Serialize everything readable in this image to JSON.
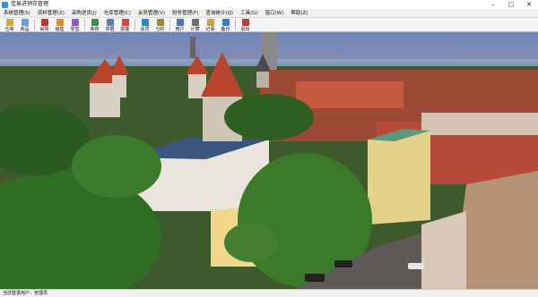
{
  "window": {
    "title": "佳易进销存管理"
  },
  "menu": {
    "items": [
      {
        "label": "系统管理(S)"
      },
      {
        "label": "资料管理(Z)"
      },
      {
        "label": "采购进货(J)"
      },
      {
        "label": "仓库管理(C)"
      },
      {
        "label": "会员管理(V)"
      },
      {
        "label": "财务管理(F)"
      },
      {
        "label": "查询统计(Q)"
      },
      {
        "label": "工具(G)"
      },
      {
        "label": "窗口(W)"
      },
      {
        "label": "帮助(Z)"
      }
    ]
  },
  "toolbar": {
    "buttons": [
      {
        "label": "仓库",
        "icon": "warehouse-icon",
        "color": "#d9a441"
      },
      {
        "label": "商品",
        "icon": "goods-icon",
        "color": "#6a9fd8"
      },
      {
        "label": "采购",
        "icon": "purchase-icon",
        "color": "#c0392b"
      },
      {
        "label": "销售",
        "icon": "sales-icon",
        "color": "#e08a2e"
      },
      {
        "label": "零售",
        "icon": "retail-icon",
        "color": "#8e5cc4"
      },
      {
        "label": "库存",
        "icon": "stock-icon",
        "color": "#3f8f4a"
      },
      {
        "label": "单据",
        "icon": "document-icon",
        "color": "#5b7fb3"
      },
      {
        "label": "报警",
        "icon": "alarm-icon",
        "color": "#d64541"
      },
      {
        "label": "会员",
        "icon": "member-icon",
        "color": "#2e86c1"
      },
      {
        "label": "分析",
        "icon": "analysis-icon",
        "color": "#9b8a3a"
      },
      {
        "label": "用户",
        "icon": "user-icon",
        "color": "#4a78b0"
      },
      {
        "label": "计算",
        "icon": "calculator-icon",
        "color": "#6d6d6d"
      },
      {
        "label": "记事",
        "icon": "notepad-icon",
        "color": "#c8a24a"
      },
      {
        "label": "备份",
        "icon": "backup-icon",
        "color": "#3a7fc2"
      },
      {
        "label": "退出",
        "icon": "exit-icon",
        "color": "#b83a3a"
      }
    ]
  },
  "status": {
    "text": "当前登录用户：管理员"
  }
}
